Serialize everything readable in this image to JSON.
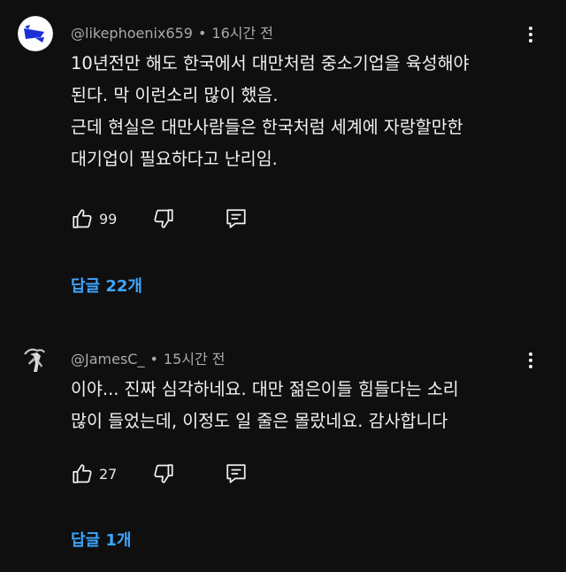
{
  "colors": {
    "background": "#0f0f0f",
    "text": "#f1f1f1",
    "meta": "#aaaaaa",
    "link": "#3ea6ff"
  },
  "comments": [
    {
      "handle": "@likephoenix659",
      "separator": "•",
      "time": "16시간 전",
      "text_lines": [
        "10년전만 해도 한국에서 대만처럼 중소기업을 육성해야",
        "된다. 막 이런소리 많이 했음.",
        "근데 현실은 대만사람들은 한국처럼 세계에 자랑할만한",
        "대기업이 필요하다고 난리임."
      ],
      "likes": "99",
      "replies_label": "답글 22개",
      "icons": {
        "avatar": "avatar-blue-flag",
        "more": "more-vertical-icon",
        "like": "thumb-up-icon",
        "dislike": "thumb-down-icon",
        "reply": "reply-icon"
      }
    },
    {
      "handle": "@JamesC_",
      "separator": "•",
      "time": "15시간 전",
      "text_lines": [
        "이야... 진짜 심각하네요. 대만 젊은이들 힘들다는 소리",
        "많이 들었는데, 이정도 일 줄은 몰랐네요. 감사합니다"
      ],
      "likes": "27",
      "replies_label": "답글 1개",
      "icons": {
        "avatar": "avatar-figure",
        "more": "more-vertical-icon",
        "like": "thumb-up-icon",
        "dislike": "thumb-down-icon",
        "reply": "reply-icon"
      }
    }
  ]
}
